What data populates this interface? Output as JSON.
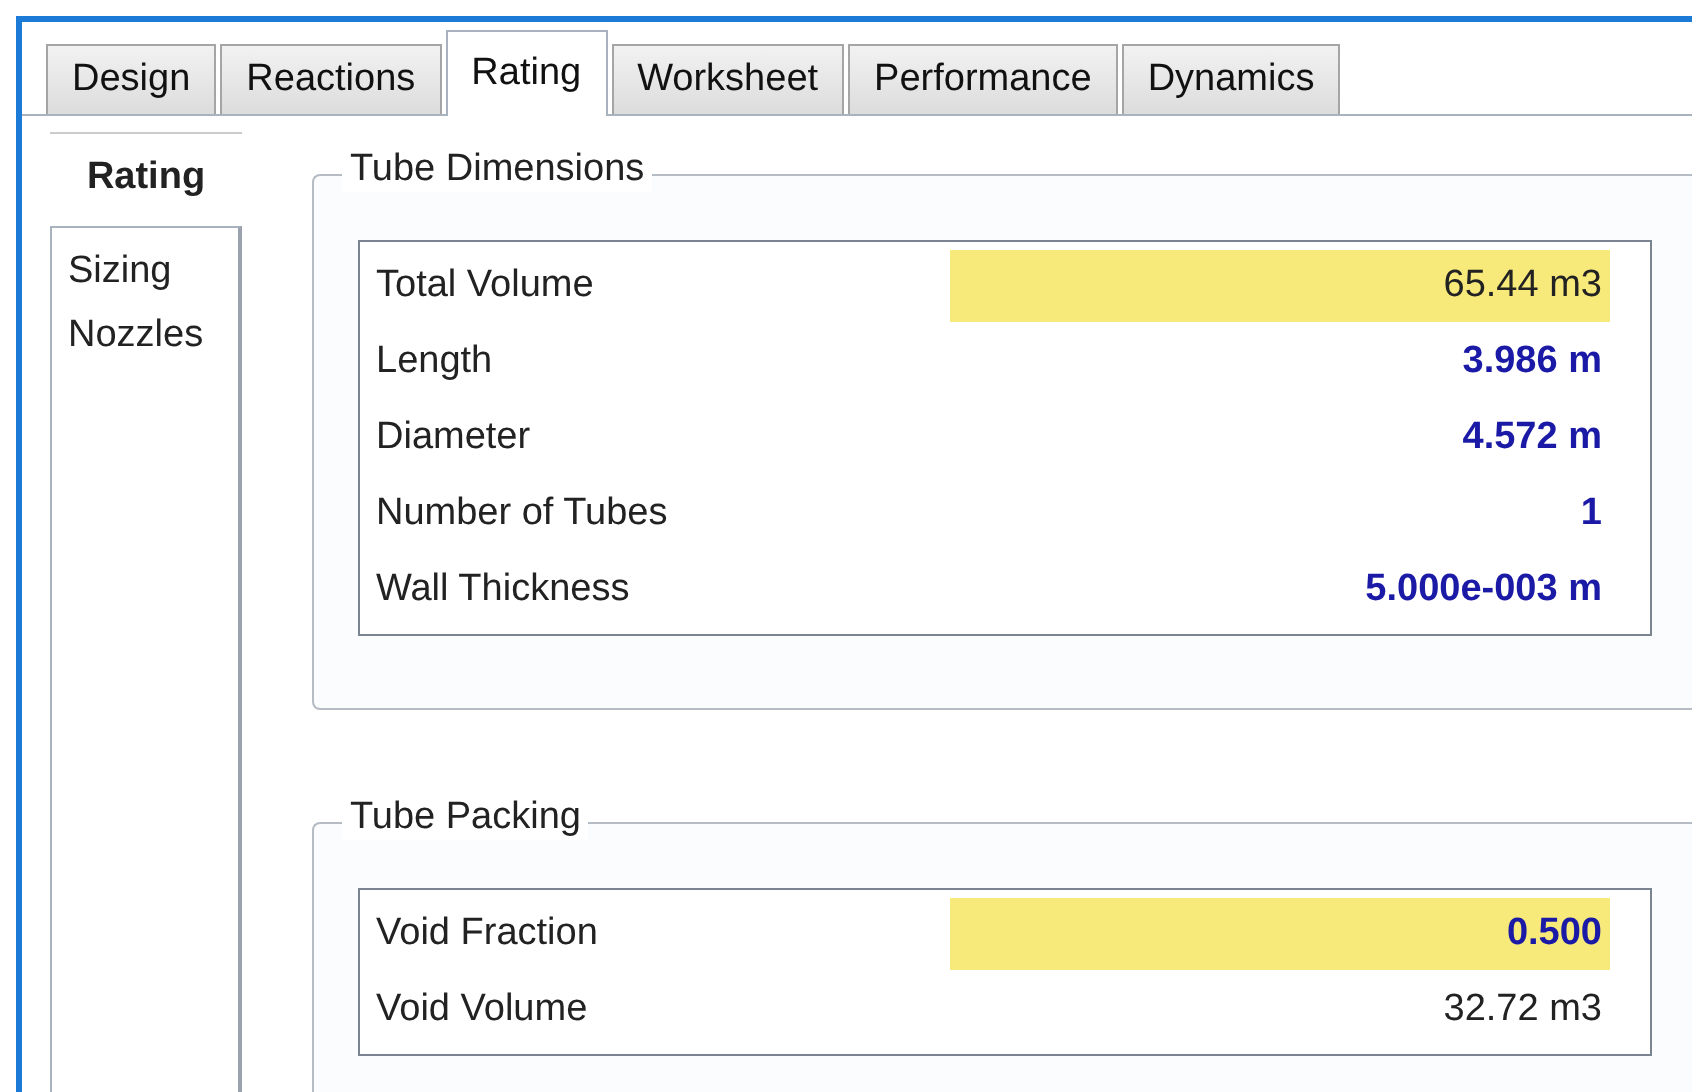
{
  "tabs": [
    {
      "label": "Design",
      "selected": false
    },
    {
      "label": "Reactions",
      "selected": false
    },
    {
      "label": "Rating",
      "selected": true
    },
    {
      "label": "Worksheet",
      "selected": false
    },
    {
      "label": "Performance",
      "selected": false
    },
    {
      "label": "Dynamics",
      "selected": false
    }
  ],
  "sidebar": {
    "items": [
      {
        "label": "Rating",
        "selected": true
      },
      {
        "label": "Sizing",
        "selected": false
      },
      {
        "label": "Nozzles",
        "selected": false
      }
    ]
  },
  "groups": [
    {
      "title": "Tube Dimensions",
      "rows": [
        {
          "label": "Total Volume",
          "value": "65.44 m3",
          "kind": "calculated",
          "selected": true
        },
        {
          "label": "Length",
          "value": "3.986 m",
          "kind": "specified",
          "selected": false
        },
        {
          "label": "Diameter",
          "value": "4.572 m",
          "kind": "specified",
          "selected": false
        },
        {
          "label": "Number of Tubes",
          "value": "1",
          "kind": "specified",
          "selected": false
        },
        {
          "label": "Wall Thickness",
          "value": "5.000e-003 m",
          "kind": "specified",
          "selected": false
        }
      ]
    },
    {
      "title": "Tube Packing",
      "rows": [
        {
          "label": "Void Fraction",
          "value": "0.500",
          "kind": "specified",
          "selected": true
        },
        {
          "label": "Void Volume",
          "value": "32.72 m3",
          "kind": "calculated",
          "selected": false
        }
      ]
    }
  ]
}
